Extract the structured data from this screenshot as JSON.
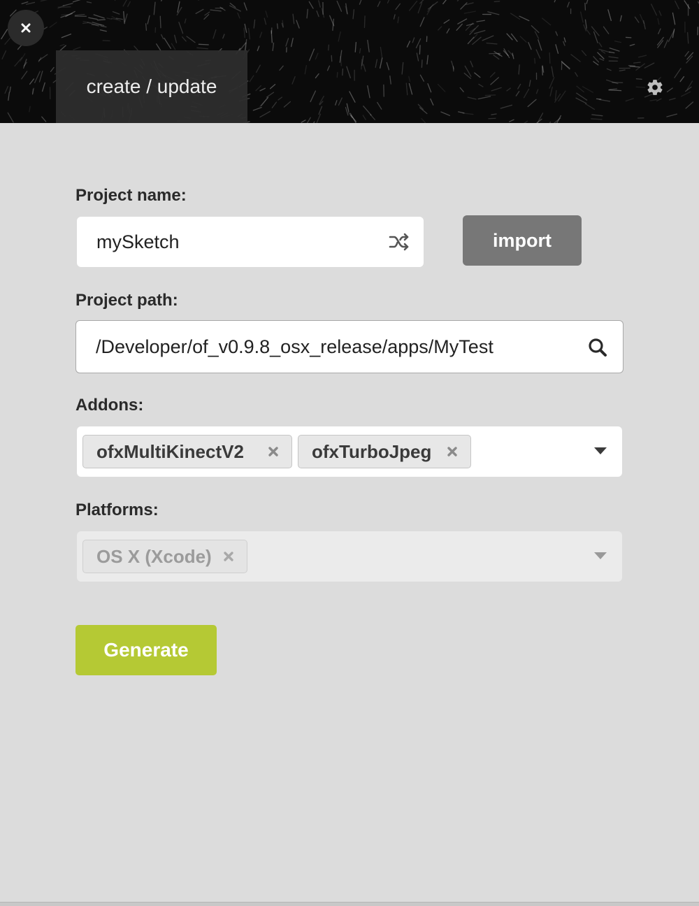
{
  "header": {
    "close_icon": "close-icon",
    "tab_label": "create / update",
    "settings_icon": "gear-icon"
  },
  "form": {
    "project_name": {
      "label": "Project name:",
      "value": "mySketch",
      "shuffle_icon": "shuffle-icon"
    },
    "import_label": "import",
    "project_path": {
      "label": "Project path:",
      "value": "/Developer/of_v0.9.8_osx_release/apps/MyTest",
      "search_icon": "search-icon"
    },
    "addons": {
      "label": "Addons:",
      "items": [
        "ofxMultiKinectV2",
        "ofxTurboJpeg"
      ]
    },
    "platforms": {
      "label": "Platforms:",
      "items": [
        "OS X (Xcode)"
      ],
      "disabled": true
    },
    "generate_label": "Generate"
  },
  "colors": {
    "background": "#dcdcdc",
    "header": "#0b0b0b",
    "generate": "#b5c934",
    "import": "#777777"
  }
}
